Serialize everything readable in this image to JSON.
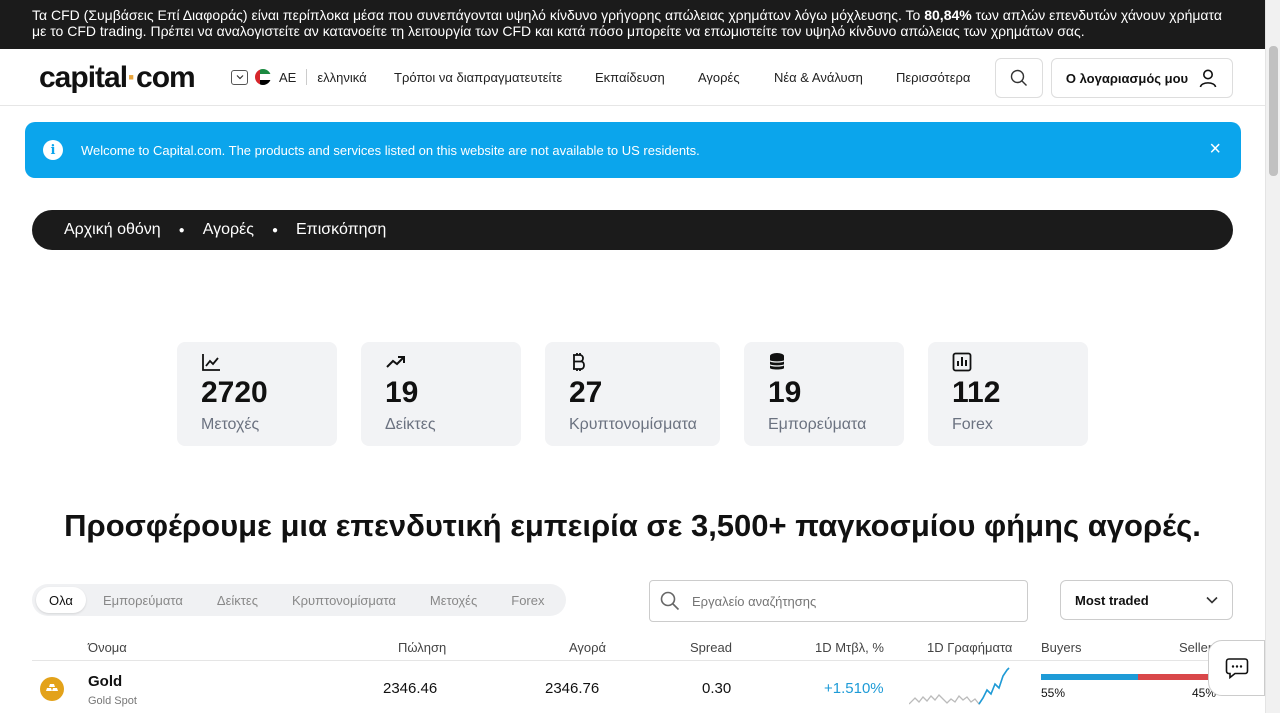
{
  "risk_warning": {
    "part1": "Τα CFD (Συμβάσεις Επί Διαφοράς) είναι περίπλοκα μέσα που συνεπάγονται υψηλό κίνδυνο γρήγορης απώλειας χρημάτων λόγω μόχλευσης. Το ",
    "percent": "80,84%",
    "part2": " των απλών επενδυτών χάνουν χρήματα με το CFD trading. Πρέπει να αναλογιστείτε αν κατανοείτε τη λειτουργία των CFD και κατά πόσο μπορείτε να επωμιστείτε τον υψηλό κίνδυνο απώλειας των χρημάτων σας."
  },
  "header": {
    "logo_left": "capital",
    "logo_dot": "·",
    "logo_right": "com",
    "region_code": "AE",
    "language": "ελληνικά",
    "nav": [
      "Τρόποι να διαπραγματευτείτε",
      "Εκπαίδευση",
      "Αγορές",
      "Νέα & Ανάλυση",
      "Περισσότερα"
    ],
    "account_label": "Ο λογαριασμός μου"
  },
  "welcome_banner": {
    "text": "Welcome to Capital.com. The products and services listed on this website are not available to US residents.",
    "close": "×",
    "info_glyph": "i"
  },
  "breadcrumb": [
    "Αρχική οθόνη",
    "Αγορές",
    "Επισκόπηση"
  ],
  "stats": [
    {
      "icon": "line-chart-icon",
      "value": "2720",
      "label": "Μετοχές"
    },
    {
      "icon": "trending-up-icon",
      "value": "19",
      "label": "Δείκτες"
    },
    {
      "icon": "bitcoin-icon",
      "value": "27",
      "label": "Κρυπτονομίσματα"
    },
    {
      "icon": "coins-stack-icon",
      "value": "19",
      "label": "Εμπορεύματα"
    },
    {
      "icon": "bar-chart-icon",
      "value": "112",
      "label": "Forex"
    }
  ],
  "headline": "Προσφέρουμε μια επενδυτική εμπειρία σε 3,500+ παγκοσμίου φήμης αγορές.",
  "filters": {
    "tabs": [
      "Ολα",
      "Εμπορεύματα",
      "Δείκτες",
      "Κρυπτονομίσματα",
      "Μετοχές",
      "Forex"
    ],
    "active_tab": "Ολα",
    "search_placeholder": "Εργαλείο αναζήτησης",
    "sort_selected": "Most traded"
  },
  "table": {
    "headers": {
      "name": "Όνομα",
      "sell": "Πώληση",
      "buy": "Αγορά",
      "spread": "Spread",
      "change": "1D Μτβλ, %",
      "chart": "1D Γραφήματα",
      "buyers": "Buyers",
      "sellers": "Sellers"
    },
    "rows": [
      {
        "name": "Gold",
        "subtitle": "Gold Spot",
        "sell": "2346.46",
        "buy": "2346.76",
        "spread": "0.30",
        "change": "+1.510%",
        "buyers_pct": "55%",
        "sellers_pct": "45%",
        "buyers_fraction": 0.55
      }
    ]
  },
  "colors": {
    "risk_bar": "#1b1b1b",
    "welcome": "#0ba5ec",
    "gold": "#e3a21a",
    "positive": "#1e9bd7",
    "buyers": "#1e9bd7",
    "sellers": "#d9474a"
  }
}
